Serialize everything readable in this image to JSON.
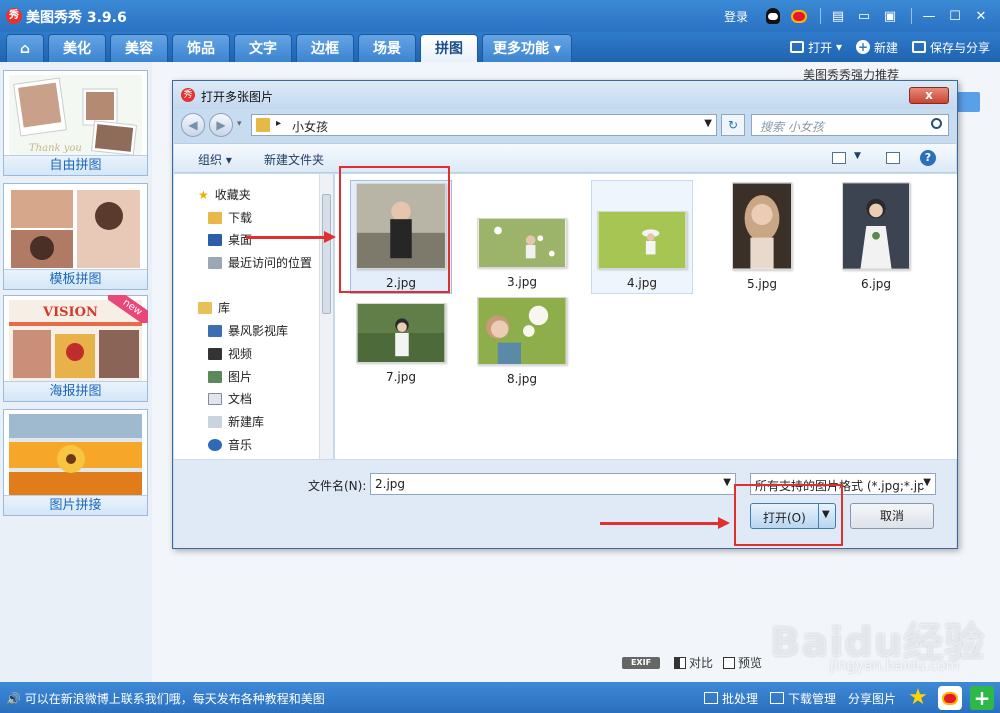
{
  "app": {
    "title": "美图秀秀 3.9.6",
    "login": "登录"
  },
  "nav": {
    "tabs": [
      "美化",
      "美容",
      "饰品",
      "文字",
      "边框",
      "场景",
      "拼图"
    ],
    "more": "更多功能",
    "open": "打开",
    "new": "新建",
    "save_share": "保存与分享"
  },
  "left_panel": {
    "items": [
      "自由拼图",
      "模板拼图",
      "海报拼图",
      "图片拼接"
    ],
    "poster_badge": "new",
    "poster_word": "VISION"
  },
  "workspace": {
    "recommend": "美图秀秀强力推荐",
    "exif": "EXIF",
    "compare": "对比",
    "preview": "预览"
  },
  "dialog": {
    "title": "打开多张图片",
    "close": "x",
    "breadcrumb": "小女孩",
    "search_placeholder": "搜索 小女孩",
    "organize": "组织",
    "new_folder": "新建文件夹",
    "favorites_header": "收藏夹",
    "favorites": [
      "下载",
      "桌面",
      "最近访问的位置"
    ],
    "library_header": "库",
    "libraries": [
      "暴风影视库",
      "视频",
      "图片",
      "文档",
      "新建库",
      "音乐"
    ],
    "files": [
      "2.jpg",
      "3.jpg",
      "4.jpg",
      "5.jpg",
      "6.jpg",
      "7.jpg",
      "8.jpg"
    ],
    "filename_label": "文件名(N):",
    "filename_value": "2.jpg",
    "filetype": "所有支持的图片格式 (*.jpg;*.jp",
    "open_button": "打开(O)",
    "cancel_button": "取消"
  },
  "status": {
    "text": "可以在新浪微博上联系我们哦，每天发布各种教程和美图",
    "batch": "批处理",
    "download": "下载管理",
    "share": "分享图片"
  },
  "watermark": {
    "brand": "Baidu经验",
    "url": "jingyan.baidu.com"
  },
  "colors": {
    "accent": "#2a72c2",
    "annotation": "#e12e2e"
  }
}
